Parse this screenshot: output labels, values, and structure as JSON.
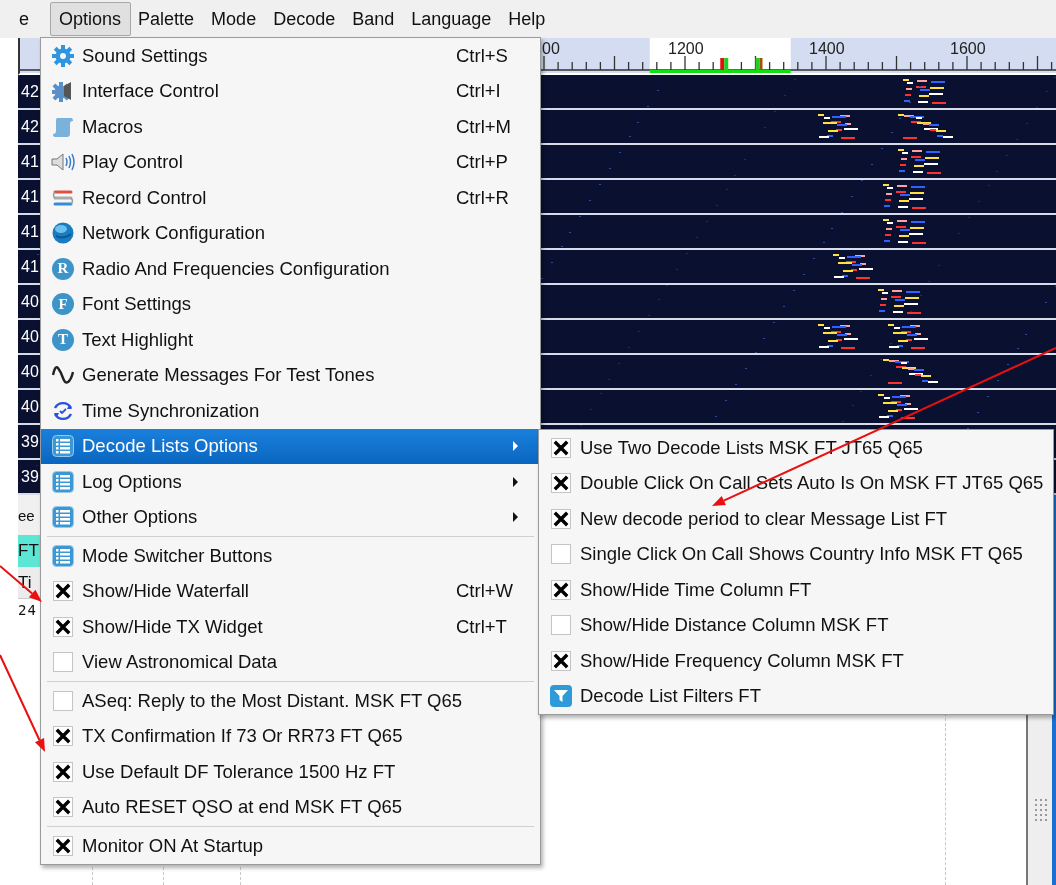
{
  "menu_bar": [
    {
      "label": "e",
      "selected": false
    },
    {
      "label": "Options",
      "selected": true
    },
    {
      "label": "Palette",
      "selected": false
    },
    {
      "label": "Mode",
      "selected": false
    },
    {
      "label": "Decode",
      "selected": false
    },
    {
      "label": "Band",
      "selected": false
    },
    {
      "label": "Language",
      "selected": false
    },
    {
      "label": "Help",
      "selected": false
    }
  ],
  "ruler": {
    "labels": [
      "00",
      "1200",
      "1400",
      "1600"
    ]
  },
  "waterfall": {
    "time_labels": [
      "42",
      "42",
      "41",
      "41",
      "41",
      "41",
      "40",
      "40",
      "40",
      "40",
      "39",
      "39"
    ]
  },
  "lower_panel": {
    "speed_label": "ee",
    "mode_tab": "FT",
    "table_header": "Ti",
    "table_cell": "24"
  },
  "options_menu": {
    "items": [
      {
        "kind": "command",
        "label": "Sound Settings",
        "shortcut": "Ctrl+S",
        "selected": false
      },
      {
        "kind": "command",
        "label": "Interface Control",
        "shortcut": "Ctrl+I",
        "selected": false
      },
      {
        "kind": "command",
        "label": "Macros",
        "shortcut": "Ctrl+M",
        "selected": false
      },
      {
        "kind": "command",
        "label": "Play Control",
        "shortcut": "Ctrl+P",
        "selected": false
      },
      {
        "kind": "command",
        "label": "Record Control",
        "shortcut": "Ctrl+R",
        "selected": false
      },
      {
        "kind": "command",
        "label": "Network Configuration",
        "selected": false
      },
      {
        "kind": "command",
        "label": "Radio And Frequencies Configuration",
        "icon_letter": "R",
        "selected": false
      },
      {
        "kind": "command",
        "label": "Font Settings",
        "icon_letter": "F",
        "selected": false
      },
      {
        "kind": "command",
        "label": "Text Highlight",
        "icon_letter": "T",
        "selected": false
      },
      {
        "kind": "command",
        "label": "Generate Messages For Test Tones",
        "selected": false
      },
      {
        "kind": "command",
        "label": "Time Synchronization",
        "selected": false
      },
      {
        "kind": "submenu",
        "label": "Decode Lists Options",
        "selected": true
      },
      {
        "kind": "submenu",
        "label": "Log Options",
        "selected": false
      },
      {
        "kind": "submenu",
        "label": "Other Options",
        "selected": false
      },
      {
        "kind": "separator"
      },
      {
        "kind": "command",
        "label": "Mode Switcher Buttons",
        "selected": false
      },
      {
        "kind": "check",
        "label": "Show/Hide Waterfall",
        "shortcut": "Ctrl+W",
        "checked": true,
        "selected": false
      },
      {
        "kind": "check",
        "label": "Show/Hide TX Widget",
        "shortcut": "Ctrl+T",
        "checked": true,
        "selected": false
      },
      {
        "kind": "check",
        "label": "View Astronomical Data",
        "checked": false,
        "selected": false
      },
      {
        "kind": "separator"
      },
      {
        "kind": "check",
        "label": "ASeq: Reply to the Most Distant. MSK FT Q65",
        "checked": false,
        "selected": false
      },
      {
        "kind": "check",
        "label": "TX Confirmation If 73 Or RR73 FT Q65",
        "checked": true,
        "selected": false
      },
      {
        "kind": "check",
        "label": "Use Default DF Tolerance 1500 Hz FT",
        "checked": true,
        "selected": false
      },
      {
        "kind": "check",
        "label": "Auto RESET QSO at end MSK FT Q65",
        "checked": true,
        "selected": false
      },
      {
        "kind": "separator"
      },
      {
        "kind": "check",
        "label": "Monitor ON At Startup",
        "checked": true,
        "selected": false
      }
    ]
  },
  "decode_lists_submenu": {
    "items": [
      {
        "kind": "check",
        "label": "Use Two Decode Lists MSK FT JT65 Q65",
        "checked": true
      },
      {
        "kind": "check",
        "label": "Double Click On Call Sets Auto Is On MSK FT JT65 Q65",
        "checked": true
      },
      {
        "kind": "check",
        "label": "New decode period to clear Message List FT",
        "checked": true
      },
      {
        "kind": "check",
        "label": "Single Click On Call Shows Country Info MSK FT Q65",
        "checked": false
      },
      {
        "kind": "check",
        "label": "Show/Hide Time Column FT",
        "checked": true
      },
      {
        "kind": "check",
        "label": "Show/Hide Distance Column MSK FT",
        "checked": false
      },
      {
        "kind": "check",
        "label": "Show/Hide Frequency Column MSK FT",
        "checked": true
      },
      {
        "kind": "filter",
        "label": "Decode List Filters FT"
      }
    ]
  }
}
